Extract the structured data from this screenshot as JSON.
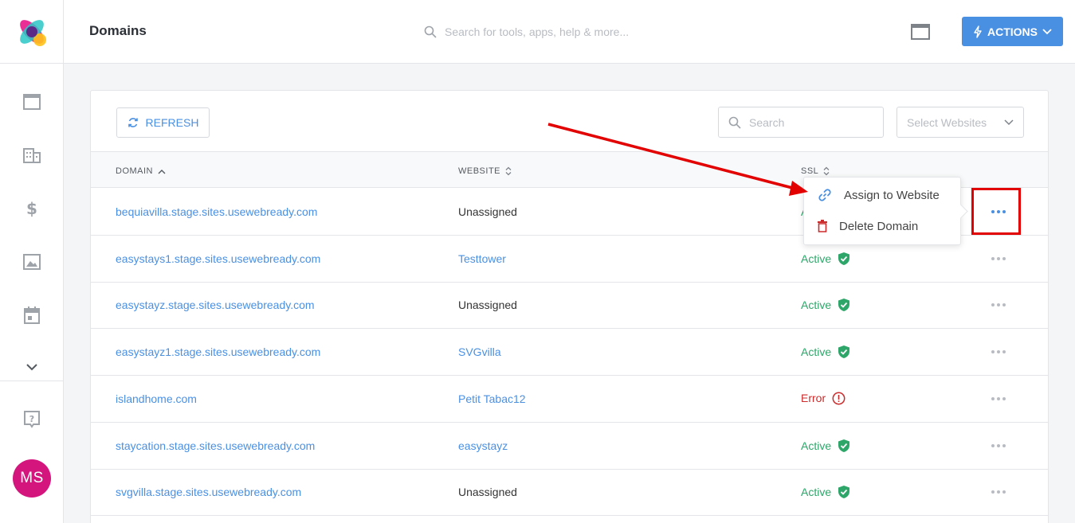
{
  "header": {
    "title": "Domains",
    "search_placeholder": "Search for tools, apps, help & more...",
    "actions_label": "ACTIONS"
  },
  "sidebar": {
    "icons": [
      "window-icon",
      "building-icon",
      "dollar-icon",
      "image-icon",
      "calendar-icon",
      "chevron-down-icon",
      "help-icon"
    ],
    "avatar_initials": "MS"
  },
  "toolbar": {
    "refresh_label": "REFRESH",
    "search_placeholder": "Search",
    "select_websites_placeholder": "Select Websites"
  },
  "table": {
    "columns": {
      "domain": "DOMAIN",
      "website": "WEBSITE",
      "ssl": "SSL"
    },
    "rows": [
      {
        "domain": "bequiavilla.stage.sites.usewebready.com",
        "website": "Unassigned",
        "ssl": "Active"
      },
      {
        "domain": "easystays1.stage.sites.usewebready.com",
        "website": "Testtower",
        "ssl": "Active"
      },
      {
        "domain": "easystayz.stage.sites.usewebready.com",
        "website": "Unassigned",
        "ssl": "Active"
      },
      {
        "domain": "easystayz1.stage.sites.usewebready.com",
        "website": "SVGvilla",
        "ssl": "Active"
      },
      {
        "domain": "islandhome.com",
        "website": "Petit Tabac12",
        "ssl": "Error"
      },
      {
        "domain": "staycation.stage.sites.usewebready.com",
        "website": "easystayz",
        "ssl": "Active"
      },
      {
        "domain": "svgvilla.stage.sites.usewebready.com",
        "website": "Unassigned",
        "ssl": "Active"
      }
    ]
  },
  "row_menu": {
    "assign_label": "Assign to Website",
    "delete_label": "Delete Domain"
  },
  "colors": {
    "accent": "#4a90e2",
    "active": "#2ea66a",
    "error": "#cc2b2b",
    "avatar": "#d4157d",
    "annotation": "#e30000"
  }
}
